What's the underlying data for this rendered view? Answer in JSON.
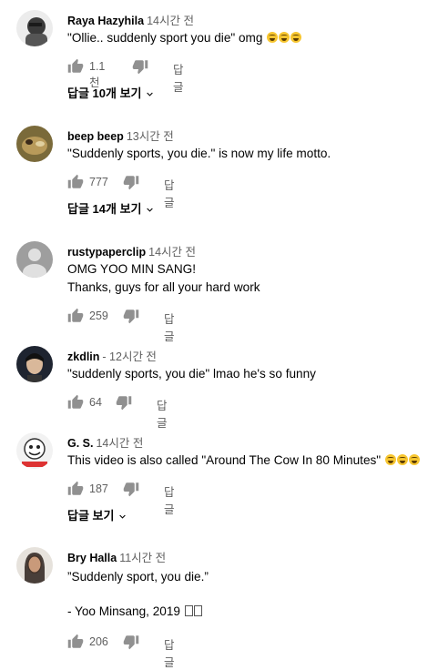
{
  "comments": [
    {
      "author": "Raya Hazyhila",
      "time": "14시간 전",
      "text": "\"Ollie.. suddenly sport you die\" omg",
      "emoji_count": 3,
      "likes": "1.1천",
      "reply_label": "답글",
      "replies_label": "답글 10개 보기",
      "avatar_color": "#3a3a3a"
    },
    {
      "author": "beep beep",
      "time": "13시간 전",
      "text": "\"Suddenly sports, you die.\" is now my life motto.",
      "likes": "777",
      "reply_label": "답글",
      "replies_label": "답글 14개 보기",
      "avatar_color": "#8a7a4a"
    },
    {
      "author": "rustypaperclip",
      "time": "14시간 전",
      "text_line1": "OMG YOO MIN SANG!",
      "text_line2": "Thanks, guys for all your hard work",
      "likes": "259",
      "reply_label": "답글",
      "avatar_color": "#9e9e9e"
    },
    {
      "author": "zkdlin",
      "time": "- 12시간 전",
      "text": "\"suddenly sports, you die\" lmao he's so funny",
      "likes": "64",
      "reply_label": "답글",
      "avatar_color": "#2a2f3a"
    },
    {
      "author": "G. S.",
      "time": "14시간 전",
      "text": "This video is also called \"Around The Cow In 80 Minutes\"",
      "emoji_count": 3,
      "likes": "187",
      "reply_label": "답글",
      "replies_label": "답글 보기",
      "avatar_color": "#e8e8e8"
    },
    {
      "author": "Bry Halla",
      "time": "11시간 전",
      "text_line1": "”Suddenly sport, you die.”",
      "text_line2": "- Yoo Minsang, 2019",
      "likes": "206",
      "reply_label": "답글",
      "avatar_color": "#5a4a3a"
    }
  ],
  "icons": {
    "like": "thumb-up-icon",
    "dislike": "thumb-down-icon",
    "expand": "chevron-down-icon"
  }
}
